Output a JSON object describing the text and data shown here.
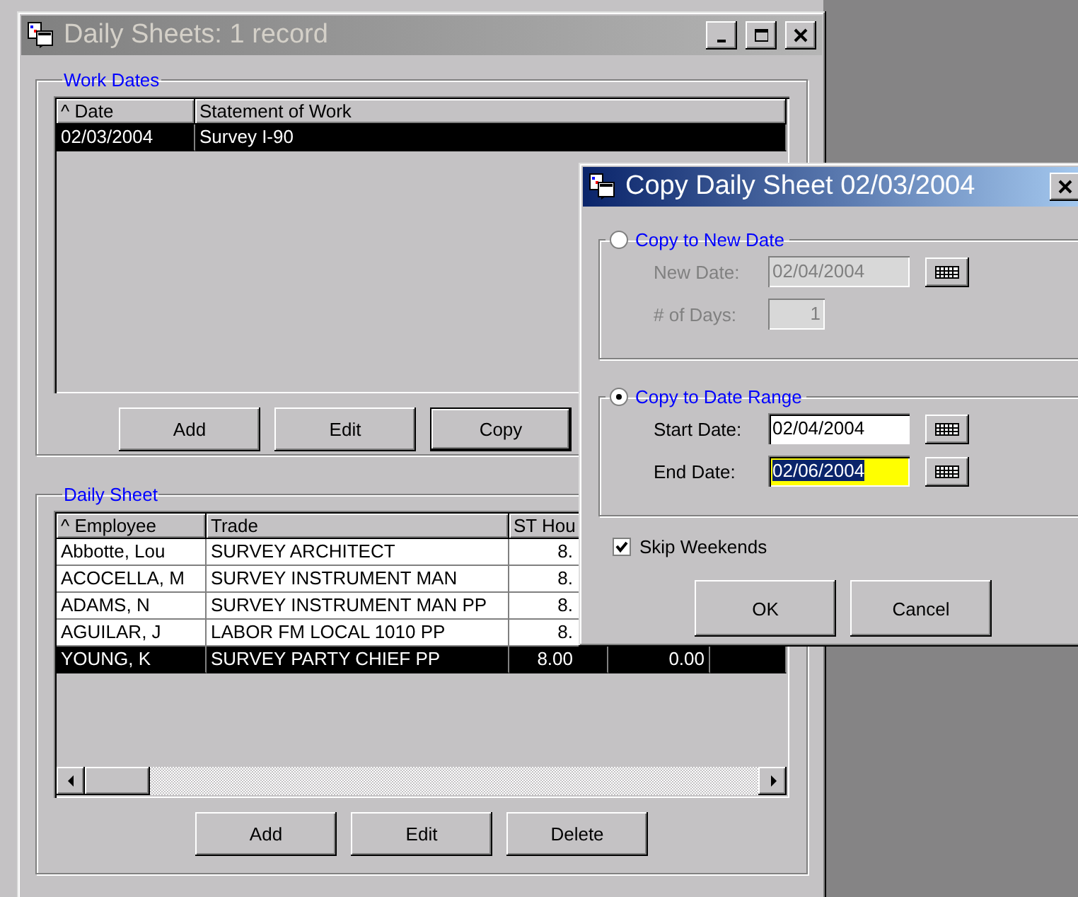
{
  "main_window": {
    "title": "Daily Sheets: 1 record",
    "active": false
  },
  "work_dates": {
    "label": "Work Dates",
    "columns": [
      "^ Date",
      "Statement of Work"
    ],
    "rows": [
      {
        "cells": [
          "02/03/2004",
          "Survey I-90"
        ],
        "selected": true
      }
    ],
    "buttons": [
      {
        "label": "Add",
        "default": false
      },
      {
        "label": "Edit",
        "default": false
      },
      {
        "label": "Copy",
        "default": true
      }
    ]
  },
  "daily_sheet": {
    "label": "Daily Sheet",
    "columns": [
      "^ Employee",
      "Trade",
      "ST Hou"
    ],
    "rows": [
      {
        "cells": [
          "Abbotte, Lou",
          "SURVEY ARCHITECT",
          "8."
        ],
        "selected": false
      },
      {
        "cells": [
          "ACOCELLA, M",
          "SURVEY INSTRUMENT MAN",
          "8."
        ],
        "selected": false
      },
      {
        "cells": [
          "ADAMS, N",
          "SURVEY INSTRUMENT MAN PP",
          "8."
        ],
        "selected": false
      },
      {
        "cells": [
          "AGUILAR, J",
          "LABOR FM LOCAL 1010 PP",
          "8."
        ],
        "selected": false
      },
      {
        "cells": [
          "YOUNG, K",
          "SURVEY PARTY CHIEF  PP",
          "8.00",
          "0.00"
        ],
        "selected": true
      }
    ],
    "buttons": [
      {
        "label": "Add",
        "default": false
      },
      {
        "label": "Edit",
        "default": false
      },
      {
        "label": "Delete",
        "default": false
      }
    ]
  },
  "dialog": {
    "title": "Copy Daily Sheet 02/03/2004",
    "active": true,
    "options": [
      {
        "label": "Copy to New Date",
        "selected": false,
        "fields": [
          {
            "kind": "date",
            "label": "New Date:",
            "value": "02/04/2004",
            "focused": false
          },
          {
            "kind": "number",
            "label": "# of Days:",
            "value": "1",
            "focused": false
          }
        ]
      },
      {
        "label": "Copy to Date Range",
        "selected": true,
        "fields": [
          {
            "kind": "date",
            "label": "Start Date:",
            "value": "02/04/2004",
            "focused": false
          },
          {
            "kind": "date",
            "label": "End Date:",
            "value": "02/06/2004",
            "focused": true
          }
        ]
      }
    ],
    "skip_weekends": {
      "label": "Skip Weekends",
      "checked": true
    },
    "buttons": [
      {
        "label": "OK",
        "default": false
      },
      {
        "label": "Cancel",
        "default": false
      }
    ]
  }
}
